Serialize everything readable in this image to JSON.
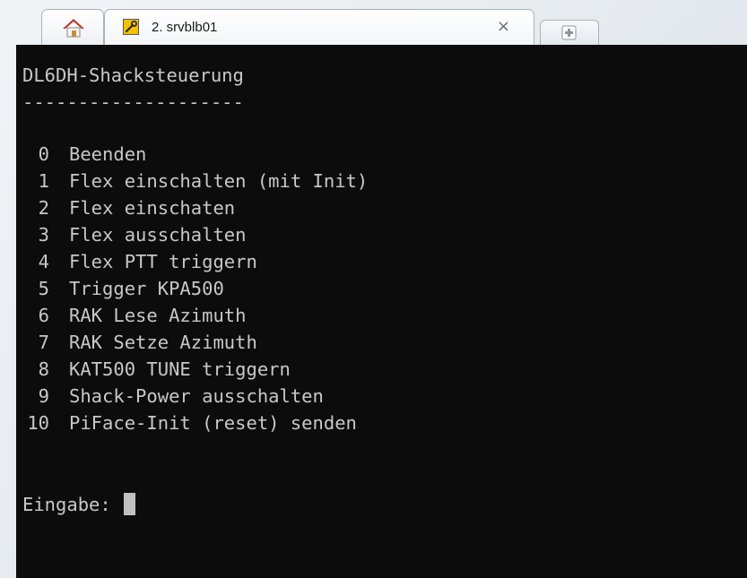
{
  "tabs": {
    "home_icon": "home-icon",
    "session": {
      "title": "2. srvblb01",
      "icon": "tool-icon",
      "close_label": "×"
    },
    "new_tab_icon": "plus-icon"
  },
  "terminal": {
    "heading": "DL6DH-Shacksteuerung",
    "separator": "--------------------",
    "menu": [
      {
        "num": "0",
        "label": "Beenden"
      },
      {
        "num": "1",
        "label": "Flex einschalten (mit Init)"
      },
      {
        "num": "2",
        "label": "Flex einschaten"
      },
      {
        "num": "3",
        "label": "Flex ausschalten"
      },
      {
        "num": "4",
        "label": "Flex PTT triggern"
      },
      {
        "num": "5",
        "label": "Trigger KPA500"
      },
      {
        "num": "6",
        "label": "RAK Lese Azimuth"
      },
      {
        "num": "7",
        "label": "RAK Setze Azimuth"
      },
      {
        "num": "8",
        "label": "KAT500 TUNE triggern"
      },
      {
        "num": "9",
        "label": "Shack-Power ausschalten"
      },
      {
        "num": "10",
        "label": "PiFace-Init (reset) senden"
      }
    ],
    "prompt": "Eingabe: "
  },
  "colors": {
    "terminal_bg": "#0c0c0c",
    "terminal_fg": "#c8c8c8",
    "home_icon_roof": "#c0392b",
    "tool_icon_bg": "#f2c200"
  }
}
